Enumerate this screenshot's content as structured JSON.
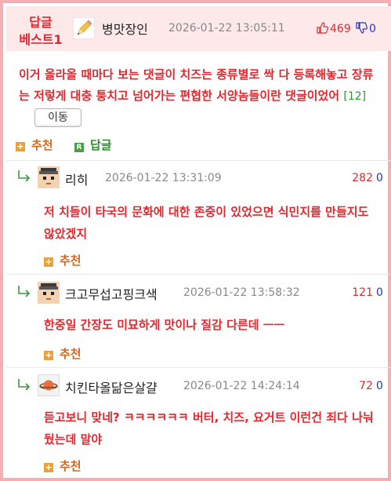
{
  "best": {
    "label_line1": "답글",
    "label_line2": "베스트1",
    "nickname": "병맛장인",
    "timestamp": "2026-01-22 13:05:11",
    "upvotes": "469",
    "downvotes": "0",
    "text": "이거 올라올 때마다 보는 댓글이 치즈는 종류별로 싹 다 등록해놓고 장류는 저렇게 대충 퉁치고 넘어가는 편협한 서양놈들이란 댓글이었어",
    "reply_count": "[12]",
    "move_label": "이동",
    "recommend_label": "추천",
    "reply_label": "답글"
  },
  "replies": [
    {
      "nickname": "리히",
      "timestamp": "2026-01-22 13:31:09",
      "upvotes": "282",
      "downvotes": "0",
      "text": "저 치들이 타국의 문화에 대한 존중이 있었으면 식민지를 만들지도 않았겠지",
      "recommend_label": "추천",
      "avatar": "pixel-face-avatar"
    },
    {
      "nickname": "크고무섭고핑크색",
      "timestamp": "2026-01-22 13:58:32",
      "upvotes": "121",
      "downvotes": "0",
      "text": "한중일 간장도 미묘하게 맛이나 질감 다른데 ㅡㅡ",
      "recommend_label": "추천",
      "avatar": "pixel-face-avatar"
    },
    {
      "nickname": "치킨타올닮은살걀",
      "timestamp": "2026-01-22 14:24:14",
      "upvotes": "72",
      "downvotes": "0",
      "text": "듣고보니 맞네? ㅋㅋㅋㅋㅋㅋ 버터, 치즈, 요거트 이런건 죄다 나눠뒀는데 말야",
      "recommend_label": "추천",
      "avatar": "planet-avatar"
    }
  ],
  "colors": {
    "accent_red": "#e0282e",
    "down_blue": "#2436b8",
    "border_pink": "#f5aeb2",
    "header_bg": "#fde9ea",
    "recommend_orange": "#d2691e",
    "reply_green": "#2a8f2a"
  }
}
